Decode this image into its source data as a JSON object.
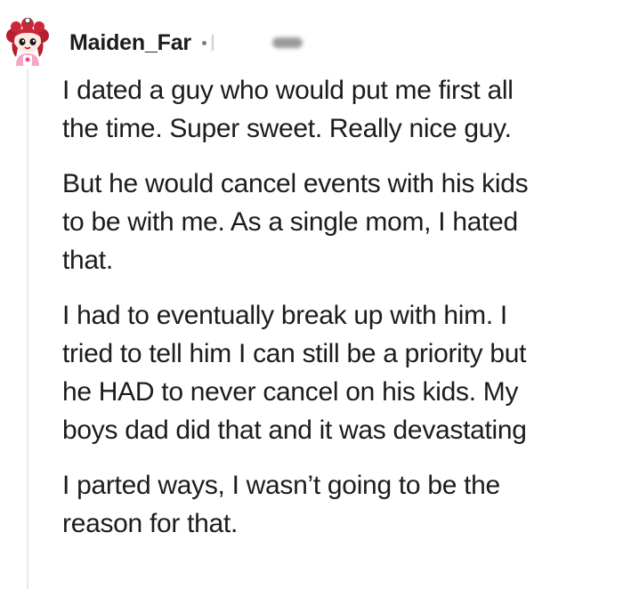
{
  "comment": {
    "username": "Maiden_Far",
    "avatar_icon": "snoo-avatar-icon",
    "paragraphs": [
      [
        "I dated a guy who would put me first all",
        "the time. Super sweet. Really nice guy."
      ],
      [
        "But he would cancel events with his kids",
        "to be with me. As a single mom, I hated",
        "that."
      ],
      [
        "I had to eventually break up with him. I",
        "tried to tell him I can still be a priority but",
        "he HAD to never cancel on his kids. My",
        "boys dad did that and it was devastating"
      ],
      [
        "I parted ways, I wasn’t going to be the",
        "reason for that."
      ]
    ]
  }
}
